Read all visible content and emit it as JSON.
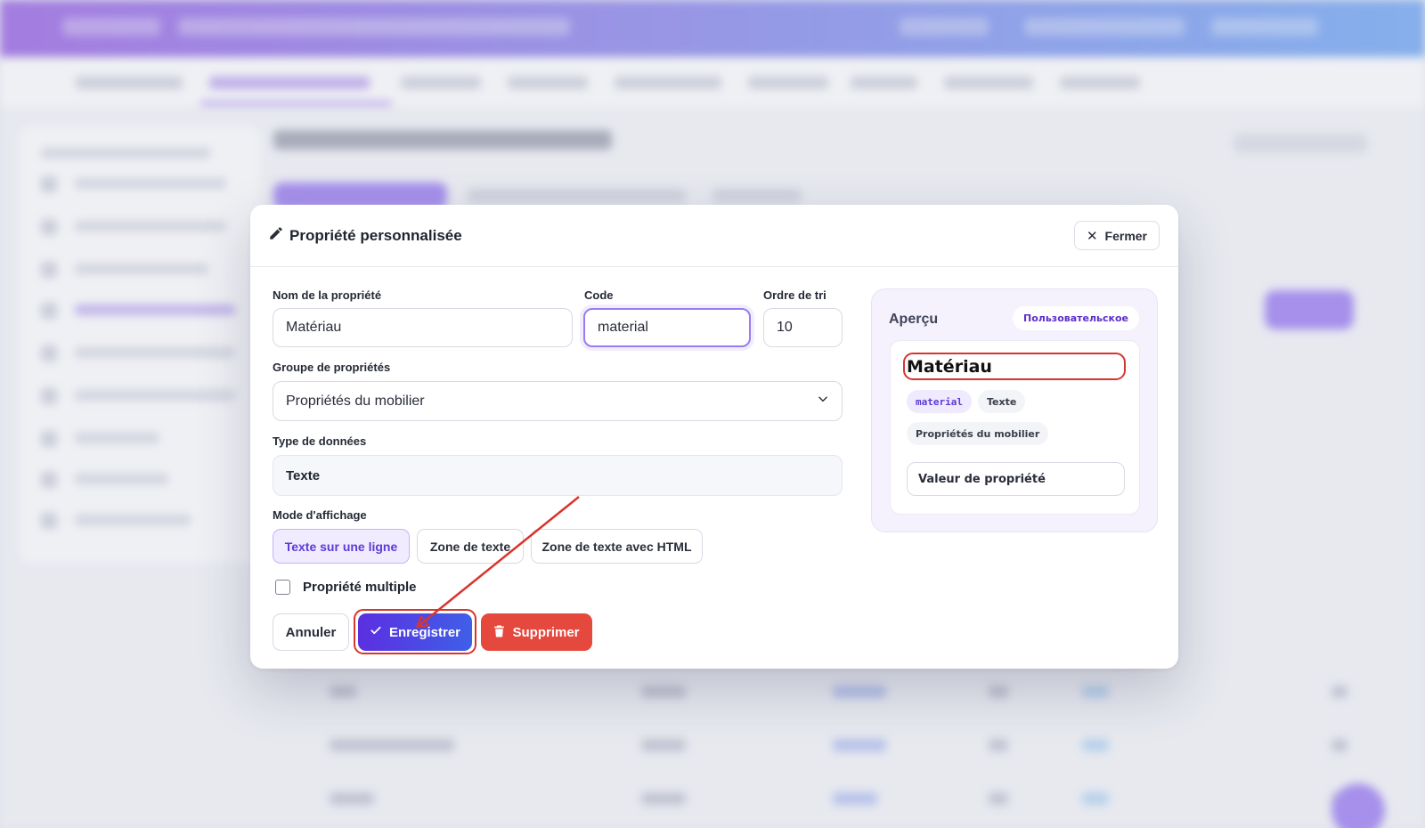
{
  "modal": {
    "title": "Propriété personnalisée",
    "close_label": "Fermer"
  },
  "form": {
    "name_label": "Nom de la propriété",
    "name_value": "Matériau",
    "code_label": "Code",
    "code_value": "material",
    "sort_label": "Ordre de tri",
    "sort_value": "10",
    "group_label": "Groupe de propriétés",
    "group_value": "Propriétés du mobilier",
    "type_label": "Type de données",
    "type_value": "Texte",
    "mode_label": "Mode d'affichage",
    "mode_options": [
      "Texte sur une ligne",
      "Zone de texte",
      "Zone de texte avec HTML"
    ],
    "mode_selected": "Texte sur une ligne",
    "multiple_label": "Propriété multiple",
    "multiple_checked": false
  },
  "actions": {
    "cancel": "Annuler",
    "save": "Enregistrer",
    "delete": "Supprimer"
  },
  "preview": {
    "title": "Aperçu",
    "badge": "Пользовательское",
    "name": "Matériau",
    "code_chip": "material",
    "type_chip": "Texte",
    "group_chip": "Propriétés du mobilier",
    "field_placeholder": "Valeur de propriété"
  },
  "colors": {
    "accent": "#5b2fe0",
    "delete": "#e5483d",
    "annotation": "#d8352e"
  },
  "icons": {
    "title": "pencil-icon",
    "close": "close-icon",
    "chevron": "chevron-down-icon",
    "save": "check-icon",
    "delete": "trash-icon"
  }
}
